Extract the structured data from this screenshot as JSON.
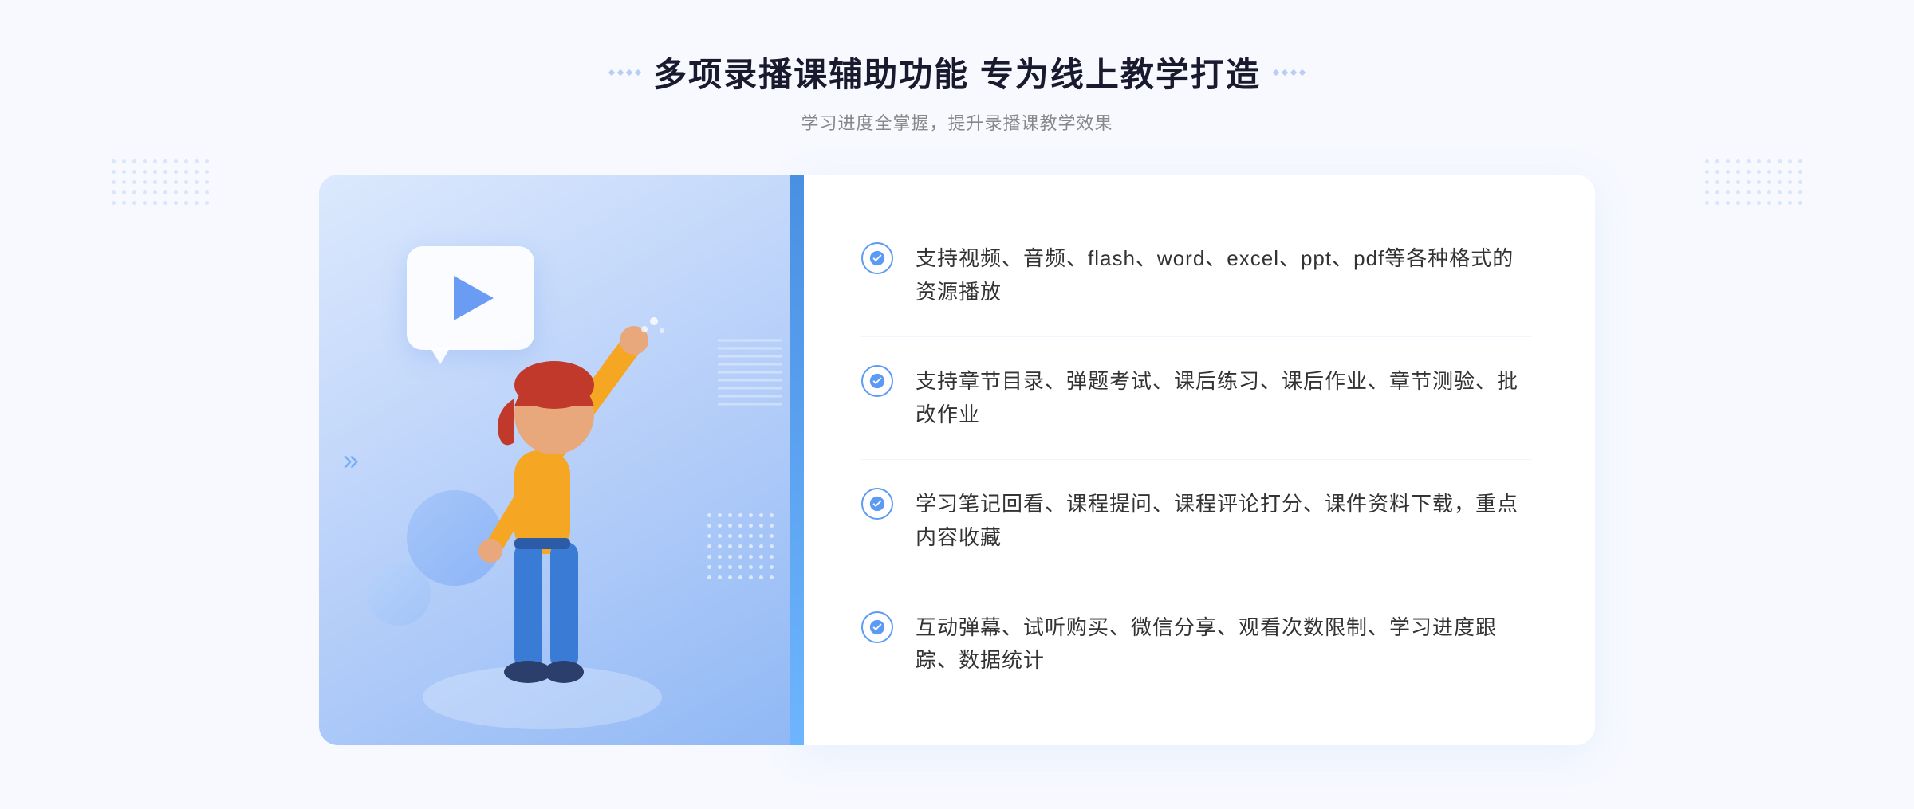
{
  "header": {
    "title": "多项录播课辅助功能 专为线上教学打造",
    "subtitle": "学习进度全掌握，提升录播课教学效果",
    "decoration_left": [
      "·",
      "·",
      "·",
      "·"
    ],
    "decoration_right": [
      "·",
      "·",
      "·",
      "·"
    ]
  },
  "features": [
    {
      "id": 1,
      "text": "支持视频、音频、flash、word、excel、ppt、pdf等各种格式的资源播放"
    },
    {
      "id": 2,
      "text": "支持章节目录、弹题考试、课后练习、课后作业、章节测验、批改作业"
    },
    {
      "id": 3,
      "text": "学习笔记回看、课程提问、课程评论打分、课件资料下载，重点内容收藏"
    },
    {
      "id": 4,
      "text": "互动弹幕、试听购买、微信分享、观看次数限制、学习进度跟踪、数据统计"
    }
  ],
  "colors": {
    "primary_blue": "#4a90e2",
    "light_blue": "#6eb5ff",
    "check_blue": "#5b9bf5",
    "bg_color": "#f7f9ff",
    "text_dark": "#333333",
    "text_gray": "#888888"
  }
}
